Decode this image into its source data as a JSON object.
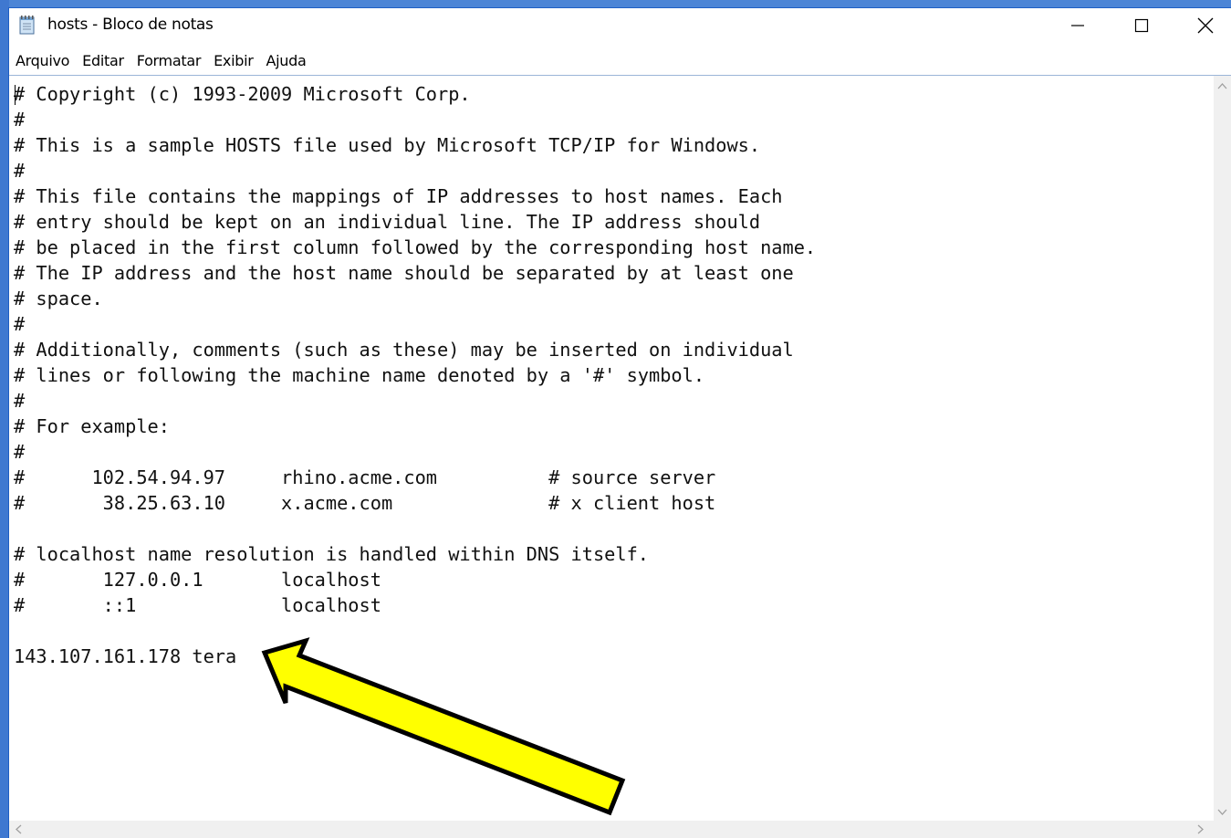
{
  "window": {
    "title": "hosts - Bloco de notas",
    "icon": "notepad-icon",
    "controls": {
      "minimize_icon": "minimize-icon",
      "maximize_icon": "maximize-icon",
      "close_icon": "close-icon"
    }
  },
  "menu": {
    "items": [
      "Arquivo",
      "Editar",
      "Formatar",
      "Exibir",
      "Ajuda"
    ]
  },
  "editor": {
    "lines": [
      "# Copyright (c) 1993-2009 Microsoft Corp.",
      "#",
      "# This is a sample HOSTS file used by Microsoft TCP/IP for Windows.",
      "#",
      "# This file contains the mappings of IP addresses to host names. Each",
      "# entry should be kept on an individual line. The IP address should",
      "# be placed in the first column followed by the corresponding host name.",
      "# The IP address and the host name should be separated by at least one",
      "# space.",
      "#",
      "# Additionally, comments (such as these) may be inserted on individual",
      "# lines or following the machine name denoted by a '#' symbol.",
      "#",
      "# For example:",
      "#",
      "#      102.54.94.97     rhino.acme.com          # source server",
      "#       38.25.63.10     x.acme.com              # x client host",
      "",
      "# localhost name resolution is handled within DNS itself.",
      "#       127.0.0.1       localhost",
      "#       ::1             localhost",
      "",
      "143.107.161.178 tera"
    ]
  },
  "annotation": {
    "arrow_color": "#ffff00",
    "arrow_outline": "#000000",
    "points_to": "143.107.161.178 tera"
  },
  "colors": {
    "desktop_blue": "#3f78d0",
    "window_bg": "#ffffff",
    "scrollbar_bg": "#f0f0f0"
  }
}
